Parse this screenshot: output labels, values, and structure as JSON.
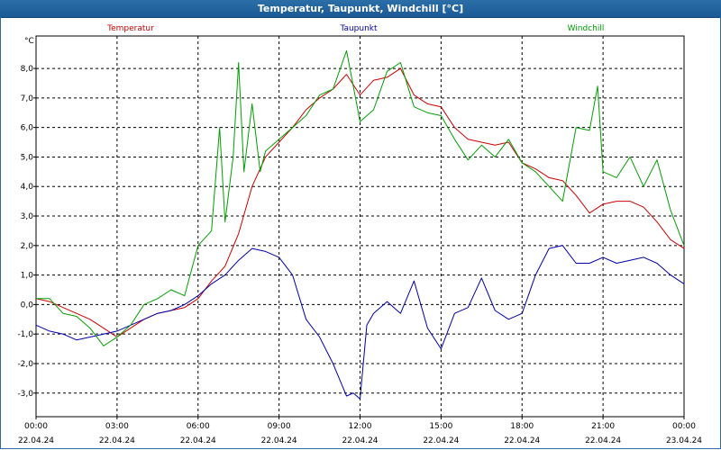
{
  "window": {
    "title": "Temperatur, Taupunkt, Windchill [°C]"
  },
  "chart_data": {
    "type": "line",
    "title": "Temperatur, Taupunkt, Windchill [°C]",
    "ylabel": "°C",
    "ylim": [
      -3.8,
      9.1
    ],
    "xlim": [
      0,
      24
    ],
    "grid": true,
    "legend_position": "top",
    "y_ticks": [
      -3.0,
      -2.0,
      -1.0,
      0.0,
      1.0,
      2.0,
      3.0,
      4.0,
      5.0,
      6.0,
      7.0,
      8.0
    ],
    "y_tick_labels": [
      "-3,0",
      "-2,0",
      "-1,0",
      "0,0",
      "1,0",
      "2,0",
      "3,0",
      "4,0",
      "5,0",
      "6,0",
      "7,0",
      "8,0"
    ],
    "x_ticks": [
      {
        "x": 0,
        "time": "00:00",
        "date": "22.04.24"
      },
      {
        "x": 3,
        "time": "03:00",
        "date": "22.04.24"
      },
      {
        "x": 6,
        "time": "06:00",
        "date": "22.04.24"
      },
      {
        "x": 9,
        "time": "09:00",
        "date": "22.04.24"
      },
      {
        "x": 12,
        "time": "12:00",
        "date": "22.04.24"
      },
      {
        "x": 15,
        "time": "15:00",
        "date": "22.04.24"
      },
      {
        "x": 18,
        "time": "18:00",
        "date": "22.04.24"
      },
      {
        "x": 21,
        "time": "21:00",
        "date": "22.04.24"
      },
      {
        "x": 24,
        "time": "00:00",
        "date": "23.04.24"
      }
    ],
    "series": [
      {
        "name": "Temperatur",
        "color": "#cc0000",
        "x": [
          0,
          0.5,
          1,
          1.5,
          2,
          2.5,
          3,
          3.5,
          4,
          4.5,
          5,
          5.5,
          6,
          6.5,
          7,
          7.5,
          8,
          8.5,
          9,
          9.5,
          10,
          10.5,
          11,
          11.5,
          12,
          12.5,
          13,
          13.5,
          14,
          14.5,
          15,
          15.5,
          16,
          16.5,
          17,
          17.5,
          18,
          18.5,
          19,
          19.5,
          20,
          20.5,
          21,
          21.5,
          22,
          22.5,
          23,
          23.5,
          24
        ],
        "values": [
          0.2,
          0.1,
          -0.1,
          -0.3,
          -0.5,
          -0.8,
          -1.1,
          -0.8,
          -0.5,
          -0.3,
          -0.2,
          -0.1,
          0.2,
          0.8,
          1.3,
          2.4,
          4.0,
          5.0,
          5.5,
          6.0,
          6.6,
          7.0,
          7.3,
          7.8,
          7.1,
          7.6,
          7.7,
          8.0,
          7.1,
          6.8,
          6.7,
          6.0,
          5.6,
          5.5,
          5.4,
          5.5,
          4.8,
          4.6,
          4.3,
          4.2,
          3.7,
          3.1,
          3.4,
          3.5,
          3.5,
          3.3,
          2.8,
          2.2,
          1.9
        ]
      },
      {
        "name": "Taupunkt",
        "color": "#0000aa",
        "x": [
          0,
          0.5,
          1,
          1.5,
          2,
          2.5,
          3,
          3.5,
          4,
          4.5,
          5,
          5.5,
          6,
          6.5,
          7,
          7.5,
          8,
          8.5,
          9,
          9.5,
          10,
          10.5,
          11,
          11.5,
          11.75,
          12,
          12.25,
          12.5,
          13,
          13.5,
          14,
          14.5,
          15,
          15.5,
          16,
          16.5,
          17,
          17.5,
          18,
          18.5,
          19,
          19.5,
          20,
          20.5,
          21,
          21.5,
          22,
          22.5,
          23,
          23.5,
          24
        ],
        "values": [
          -0.7,
          -0.9,
          -1.0,
          -1.2,
          -1.1,
          -1.0,
          -0.9,
          -0.7,
          -0.5,
          -0.3,
          -0.2,
          0.0,
          0.3,
          0.7,
          1.0,
          1.5,
          1.9,
          1.8,
          1.6,
          1.0,
          -0.5,
          -1.1,
          -2.0,
          -3.1,
          -3.0,
          -3.2,
          -0.7,
          -0.3,
          0.1,
          -0.3,
          0.8,
          -0.8,
          -1.5,
          -0.3,
          -0.1,
          0.9,
          -0.2,
          -0.5,
          -0.3,
          1.0,
          1.9,
          2.0,
          1.4,
          1.4,
          1.6,
          1.4,
          1.5,
          1.6,
          1.4,
          1.0,
          0.7
        ]
      },
      {
        "name": "Windchill",
        "color": "#00a000",
        "x": [
          0,
          0.5,
          1,
          1.5,
          2,
          2.5,
          3,
          3.5,
          4,
          4.5,
          5,
          5.5,
          6,
          6.5,
          6.8,
          7,
          7.3,
          7.5,
          7.7,
          8,
          8.3,
          8.5,
          9,
          9.5,
          10,
          10.5,
          11,
          11.5,
          12,
          12.5,
          13,
          13.5,
          14,
          14.5,
          15,
          15.5,
          16,
          16.5,
          17,
          17.5,
          18,
          18.5,
          19,
          19.5,
          20,
          20.5,
          20.8,
          21,
          21.5,
          22,
          22.5,
          23,
          23.5,
          24
        ],
        "values": [
          0.2,
          0.2,
          -0.3,
          -0.4,
          -0.8,
          -1.4,
          -1.1,
          -0.7,
          0.0,
          0.2,
          0.5,
          0.3,
          2.0,
          2.5,
          6.0,
          2.8,
          5.0,
          8.2,
          4.5,
          6.8,
          4.5,
          5.2,
          5.6,
          6.0,
          6.4,
          7.1,
          7.3,
          8.6,
          6.2,
          6.6,
          7.9,
          8.2,
          6.7,
          6.5,
          6.4,
          5.6,
          4.9,
          5.4,
          5.0,
          5.6,
          4.8,
          4.5,
          4.0,
          3.5,
          6.0,
          5.9,
          7.4,
          4.5,
          4.3,
          5.0,
          4.0,
          4.9,
          3.2,
          2.0
        ]
      }
    ]
  }
}
